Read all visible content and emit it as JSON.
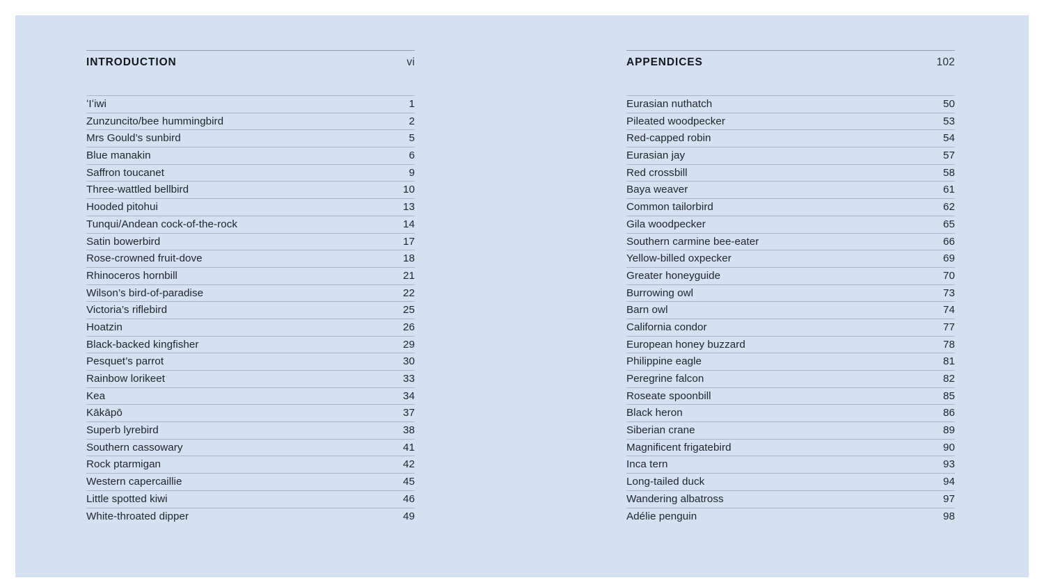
{
  "page": {
    "background_color": "#d4e1f2",
    "frame_color": "#ffffff",
    "text_color": "#20262d",
    "rule_color": "#a8b7c8",
    "header_rule_color": "#8d9cae"
  },
  "columns": [
    {
      "header": {
        "title": "INTRODUCTION",
        "page": "vi"
      },
      "entries": [
        {
          "title": "ʻIʻiwi",
          "page": "1"
        },
        {
          "title": "Zunzuncito/bee hummingbird",
          "page": "2"
        },
        {
          "title": "Mrs Gould’s sunbird",
          "page": "5"
        },
        {
          "title": "Blue manakin",
          "page": "6"
        },
        {
          "title": "Saffron toucanet",
          "page": "9"
        },
        {
          "title": "Three-wattled bellbird",
          "page": "10"
        },
        {
          "title": "Hooded pitohui",
          "page": "13"
        },
        {
          "title": "Tunqui/Andean cock-of-the-rock",
          "page": "14"
        },
        {
          "title": "Satin bowerbird",
          "page": "17"
        },
        {
          "title": "Rose-crowned fruit-dove",
          "page": "18"
        },
        {
          "title": "Rhinoceros hornbill",
          "page": "21"
        },
        {
          "title": "Wilson’s bird-of-paradise",
          "page": "22"
        },
        {
          "title": "Victoria’s riflebird",
          "page": "25"
        },
        {
          "title": "Hoatzin",
          "page": "26"
        },
        {
          "title": "Black-backed kingfisher",
          "page": "29"
        },
        {
          "title": "Pesquet’s parrot",
          "page": "30"
        },
        {
          "title": "Rainbow lorikeet",
          "page": "33"
        },
        {
          "title": "Kea",
          "page": "34"
        },
        {
          "title": "Kākāpō",
          "page": "37"
        },
        {
          "title": "Superb lyrebird",
          "page": "38"
        },
        {
          "title": "Southern cassowary",
          "page": "41"
        },
        {
          "title": "Rock ptarmigan",
          "page": "42"
        },
        {
          "title": "Western capercaillie",
          "page": "45"
        },
        {
          "title": "Little spotted kiwi",
          "page": "46"
        },
        {
          "title": "White-throated dipper",
          "page": "49"
        }
      ]
    },
    {
      "header": {
        "title": "APPENDICES",
        "page": "102"
      },
      "entries": [
        {
          "title": "Eurasian nuthatch",
          "page": "50"
        },
        {
          "title": "Pileated woodpecker",
          "page": "53"
        },
        {
          "title": "Red-capped robin",
          "page": "54"
        },
        {
          "title": "Eurasian jay",
          "page": "57"
        },
        {
          "title": "Red crossbill",
          "page": "58"
        },
        {
          "title": "Baya weaver",
          "page": "61"
        },
        {
          "title": "Common tailorbird",
          "page": "62"
        },
        {
          "title": "Gila woodpecker",
          "page": "65"
        },
        {
          "title": "Southern carmine bee-eater",
          "page": "66"
        },
        {
          "title": "Yellow-billed oxpecker",
          "page": "69"
        },
        {
          "title": "Greater honeyguide",
          "page": "70"
        },
        {
          "title": "Burrowing owl",
          "page": "73"
        },
        {
          "title": "Barn owl",
          "page": "74"
        },
        {
          "title": "California condor",
          "page": "77"
        },
        {
          "title": "European honey buzzard",
          "page": "78"
        },
        {
          "title": "Philippine eagle",
          "page": "81"
        },
        {
          "title": "Peregrine falcon",
          "page": "82"
        },
        {
          "title": "Roseate spoonbill",
          "page": "85"
        },
        {
          "title": "Black heron",
          "page": "86"
        },
        {
          "title": "Siberian crane",
          "page": "89"
        },
        {
          "title": "Magnificent frigatebird",
          "page": "90"
        },
        {
          "title": "Inca tern",
          "page": "93"
        },
        {
          "title": "Long-tailed duck",
          "page": "94"
        },
        {
          "title": "Wandering albatross",
          "page": "97"
        },
        {
          "title": "Adélie penguin",
          "page": "98"
        }
      ]
    }
  ]
}
